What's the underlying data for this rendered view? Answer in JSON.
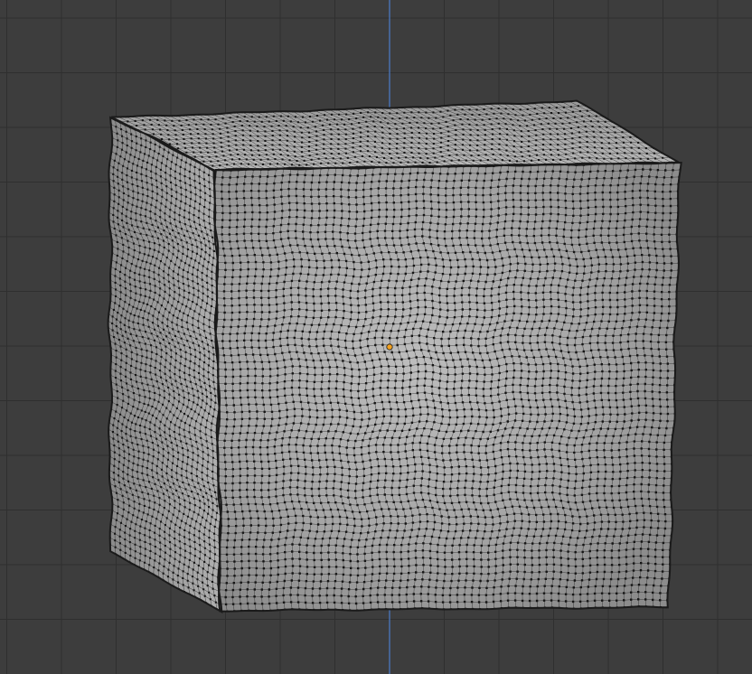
{
  "viewport": {
    "mode": "edit-mode-vertex-select",
    "view": "front-orthographic",
    "overlays": {
      "grid": true,
      "z_axis_line": true,
      "origin_marker": true
    },
    "object": {
      "name_visible": false,
      "shape": "deformed-subdivided-cube",
      "display": "solid-shaded-with-vertices"
    }
  },
  "colors": {
    "background": "#3d3d3d",
    "grid_line": "#2f2f2f",
    "axis_z": "#4a78c0",
    "mesh_face": "#a9a9a9",
    "mesh_shadow": "#5e5e5e",
    "mesh_highlight": "#c8c8c8",
    "vertex": "#151515",
    "edge": "#1e1e1e",
    "origin": "#f0a020"
  }
}
